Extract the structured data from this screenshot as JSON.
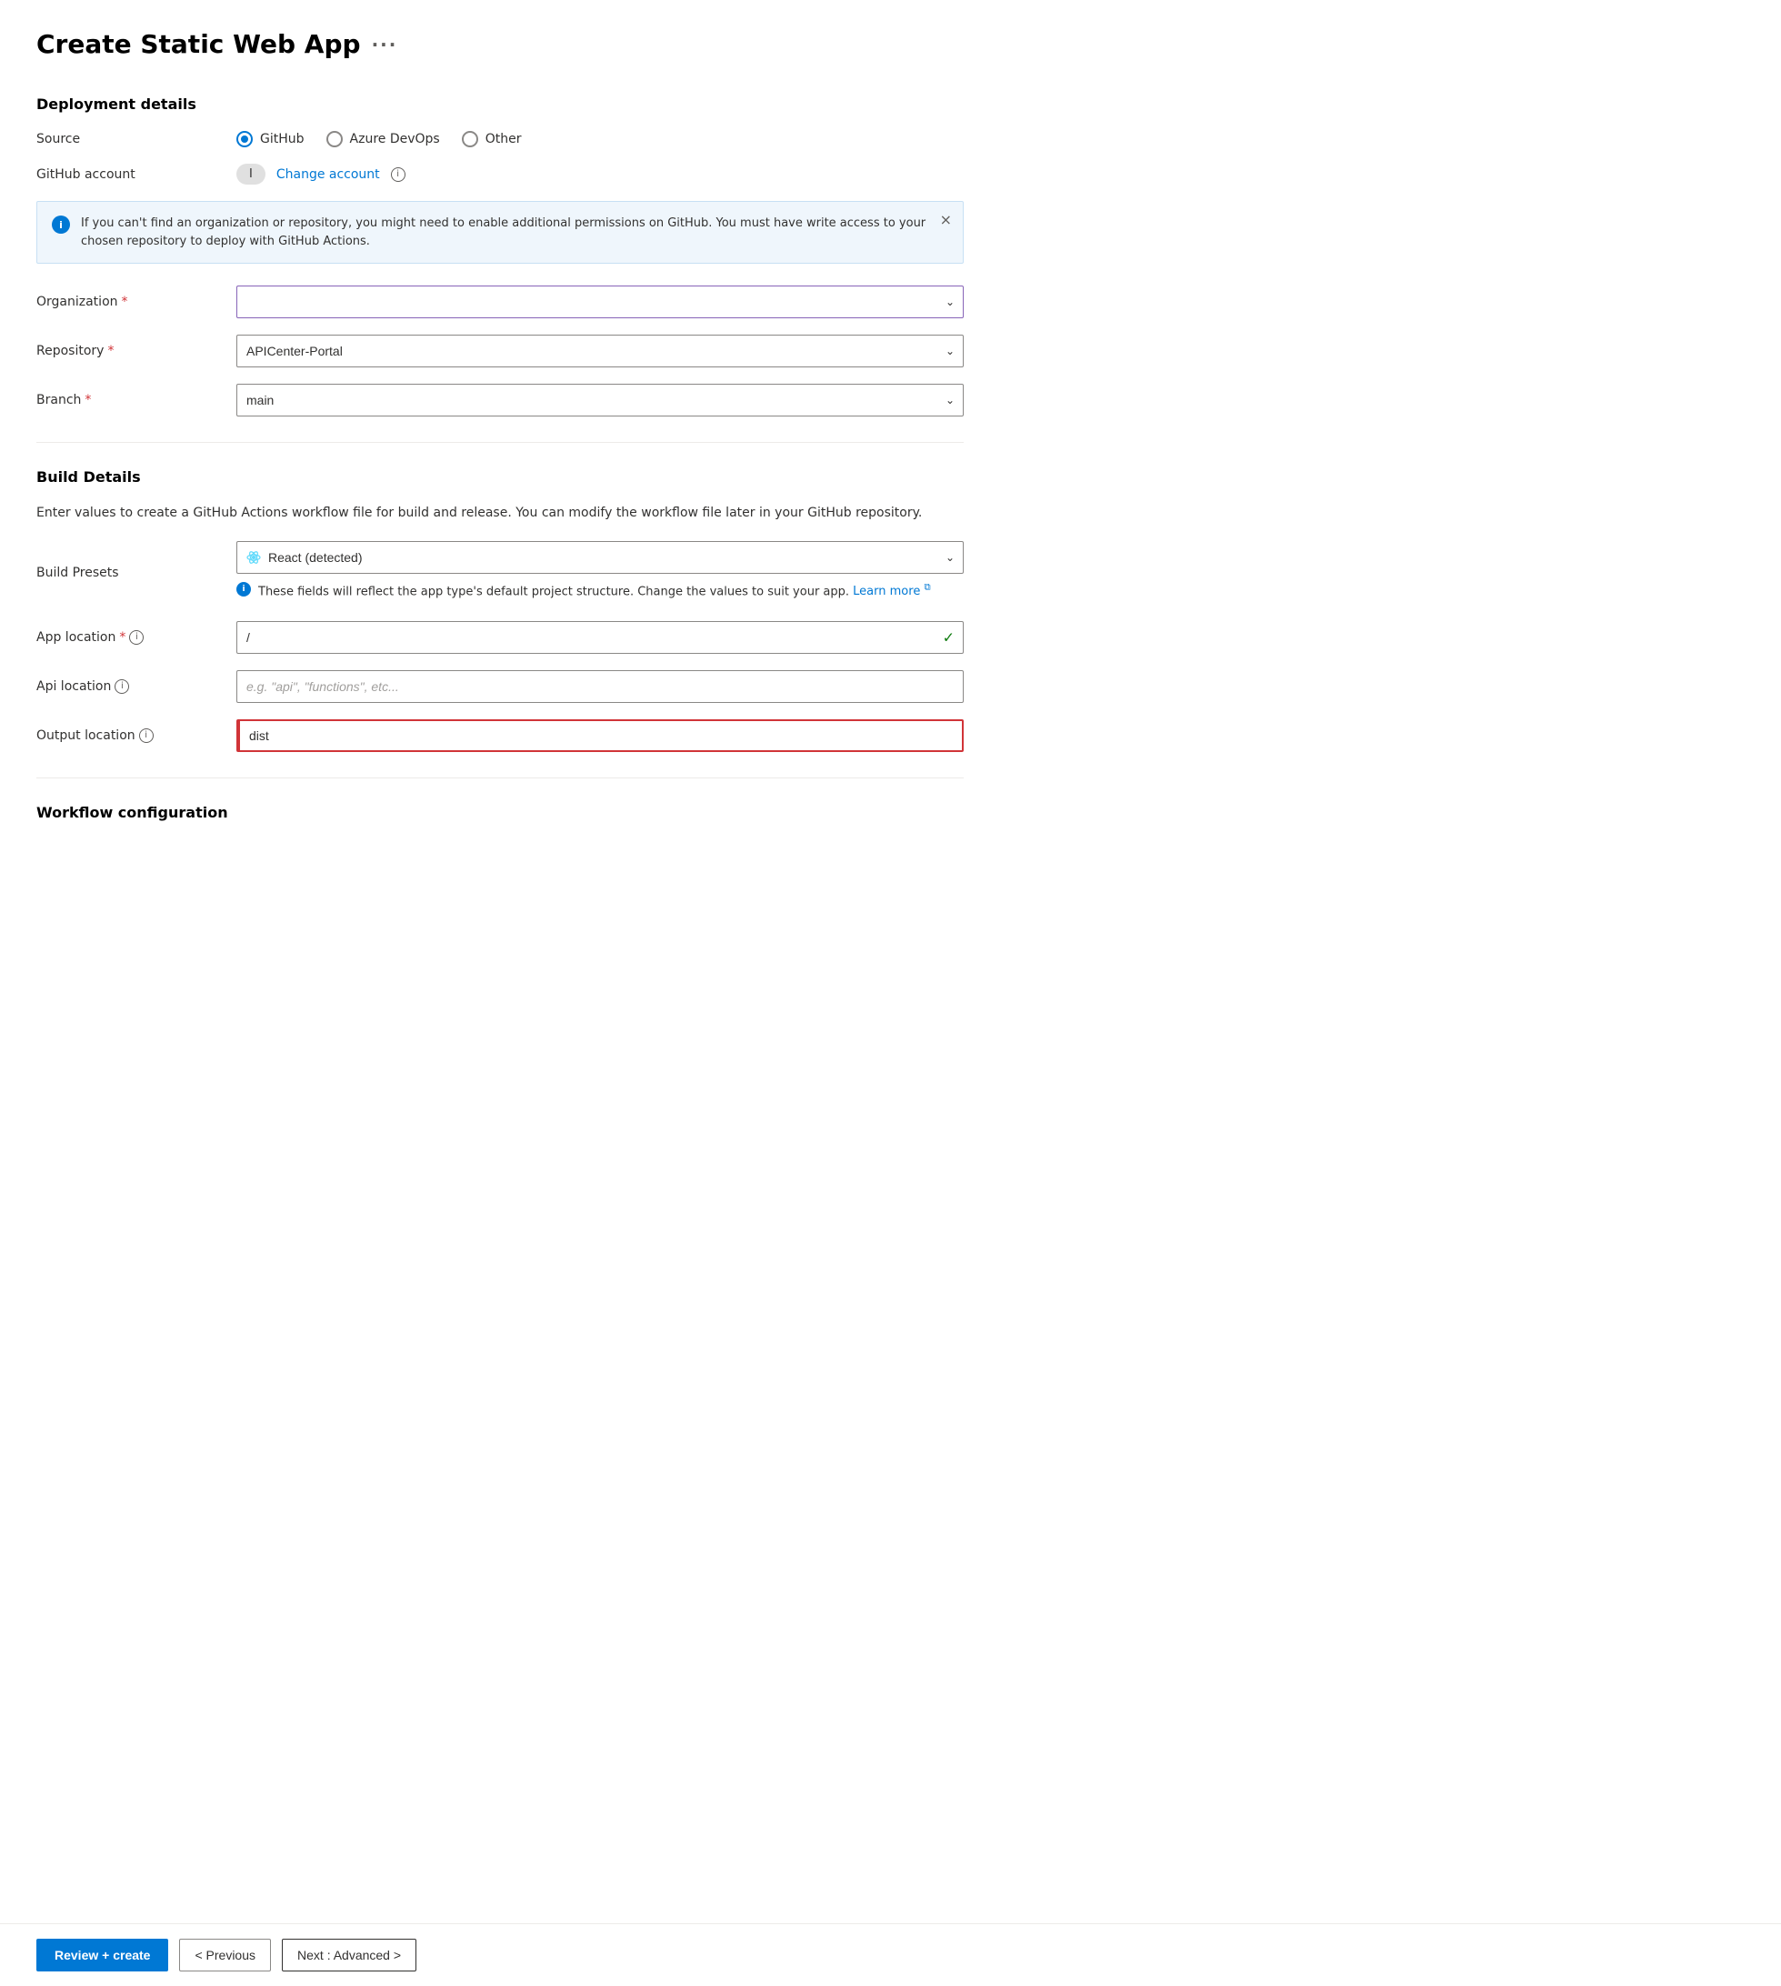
{
  "page": {
    "title": "Create Static Web App",
    "title_dots": "···"
  },
  "deployment": {
    "section_title": "Deployment details",
    "source_label": "Source",
    "source_options": [
      {
        "id": "github",
        "label": "GitHub",
        "selected": true
      },
      {
        "id": "azure-devops",
        "label": "Azure DevOps",
        "selected": false
      },
      {
        "id": "other",
        "label": "Other",
        "selected": false
      }
    ],
    "github_account_label": "GitHub account",
    "github_account_value": "I",
    "change_account_label": "Change account",
    "organization_label": "Organization",
    "repository_label": "Repository",
    "repository_value": "APICenter-Portal",
    "branch_label": "Branch",
    "branch_value": "main"
  },
  "banner": {
    "text": "If you can't find an organization or repository, you might need to enable additional permissions on GitHub. You must have write access to your chosen repository to deploy with GitHub Actions."
  },
  "build": {
    "section_title": "Build Details",
    "description": "Enter values to create a GitHub Actions workflow file for build and release. You can modify the workflow file later in your GitHub repository.",
    "presets_label": "Build Presets",
    "presets_value": "React (detected)",
    "hint_text": "These fields will reflect the app type's default project structure. Change the values to suit your app.",
    "learn_more_label": "Learn more",
    "app_location_label": "App location",
    "app_location_value": "/",
    "api_location_label": "Api location",
    "api_location_placeholder": "e.g. \"api\", \"functions\", etc...",
    "output_location_label": "Output location",
    "output_location_value": "dist"
  },
  "workflow": {
    "section_title": "Workflow configuration"
  },
  "footer": {
    "review_create_label": "Review + create",
    "previous_label": "< Previous",
    "next_label": "Next : Advanced >"
  },
  "icons": {
    "info": "i",
    "close": "×",
    "chevron_down": "⌄",
    "checkmark": "✓"
  }
}
